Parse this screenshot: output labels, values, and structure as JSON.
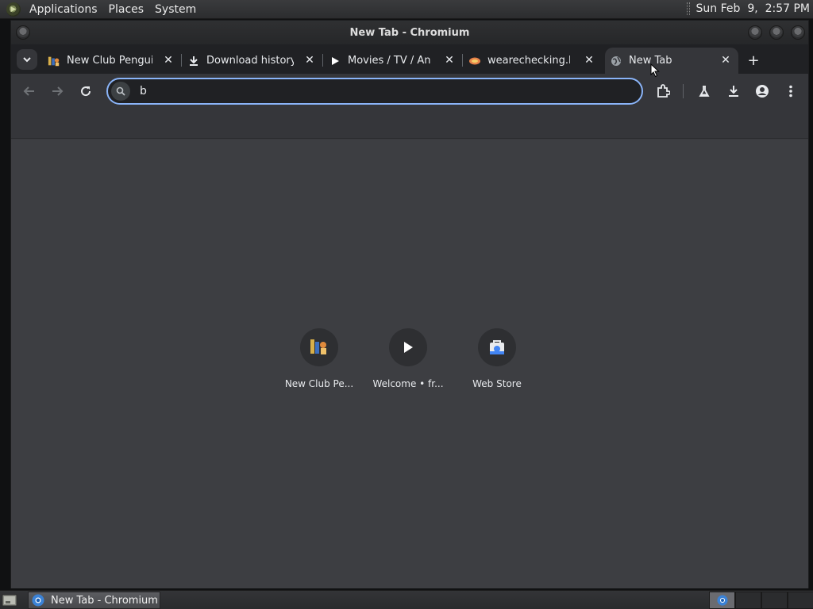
{
  "top_panel": {
    "menus": [
      "Applications",
      "Places",
      "System"
    ],
    "clock": "Sun Feb  9,  2:57 PM"
  },
  "window": {
    "title": "New Tab - Chromium"
  },
  "tabs": [
    {
      "title": "New Club Penguin",
      "icon": "club-penguin-icon",
      "active": false
    },
    {
      "title": "Download history",
      "icon": "download-icon",
      "active": false
    },
    {
      "title": "Movies / TV / Anime",
      "icon": "play-icon",
      "active": false
    },
    {
      "title": "wearechecking.live",
      "icon": "wearechecking-icon",
      "active": false
    },
    {
      "title": "New Tab",
      "icon": "globe-icon",
      "active": true
    }
  ],
  "omnibox": {
    "value": "b"
  },
  "shortcuts": [
    {
      "label": "New Club Pe...",
      "icon": "club-penguin-icon"
    },
    {
      "label": "Welcome • fr...",
      "icon": "play-icon"
    },
    {
      "label": "Web Store",
      "icon": "web-store-icon"
    }
  ],
  "taskbar": {
    "task_label": "New Tab - Chromium"
  },
  "colors": {
    "accent": "#8ab4f8",
    "tabstrip_bg": "#202124",
    "toolbar_bg": "#35363a",
    "content_bg": "#3d3e42"
  }
}
